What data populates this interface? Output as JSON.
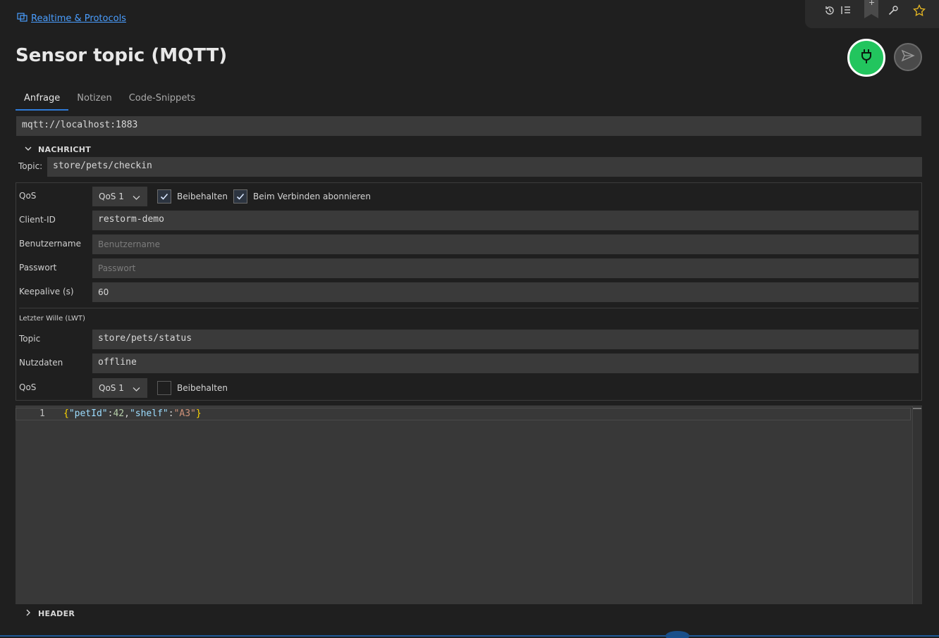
{
  "breadcrumb": {
    "icon": "folder-network-icon",
    "label": "Realtime & Protocols"
  },
  "title": "Sensor topic (MQTT)",
  "toolbar": {
    "icons": [
      "history-icon",
      "list-icon",
      "bookmark-icon",
      "wrench-icon",
      "star-icon"
    ],
    "bookmark_plus": "+"
  },
  "tabs": [
    "Anfrage",
    "Notizen",
    "Code-Snippets"
  ],
  "url": "mqtt://localhost:1883",
  "message_section": "NACHRICHT",
  "topic": {
    "label": "Topic:",
    "value": "store/pets/checkin"
  },
  "settings": {
    "qos": {
      "label": "QoS",
      "value": "QoS 1"
    },
    "retain": {
      "label": "Beibehalten",
      "checked": true
    },
    "subscribe": {
      "label": "Beim Verbinden abonnieren",
      "checked": true
    },
    "client_id": {
      "label": "Client-ID",
      "value": "restorm-demo"
    },
    "username": {
      "label": "Benutzername",
      "placeholder": "Benutzername"
    },
    "password": {
      "label": "Passwort",
      "placeholder": "Passwort"
    },
    "keepalive": {
      "label": "Keepalive (s)",
      "value": "60"
    },
    "lwt_title": "Letzter Wille (LWT)",
    "lwt_topic": {
      "label": "Topic",
      "value": "store/pets/status"
    },
    "lwt_payload": {
      "label": "Nutzdaten",
      "value": "offline"
    },
    "lwt_qos": {
      "label": "QoS",
      "value": "QoS 1"
    },
    "lwt_retain": {
      "label": "Beibehalten",
      "checked": false
    }
  },
  "editor": {
    "line_number": "1",
    "tokens": {
      "open": "{",
      "k1": "\"petId\"",
      "c1": ":",
      "v1": "42",
      "comma": ",",
      "k2": "\"shelf\"",
      "c2": ":",
      "v2": "\"A3\"",
      "close": "}"
    }
  },
  "header_section": "HEADER",
  "colors": {
    "connect": "#22c55e",
    "accent": "#2f7ad6",
    "link": "#4a9eff"
  }
}
